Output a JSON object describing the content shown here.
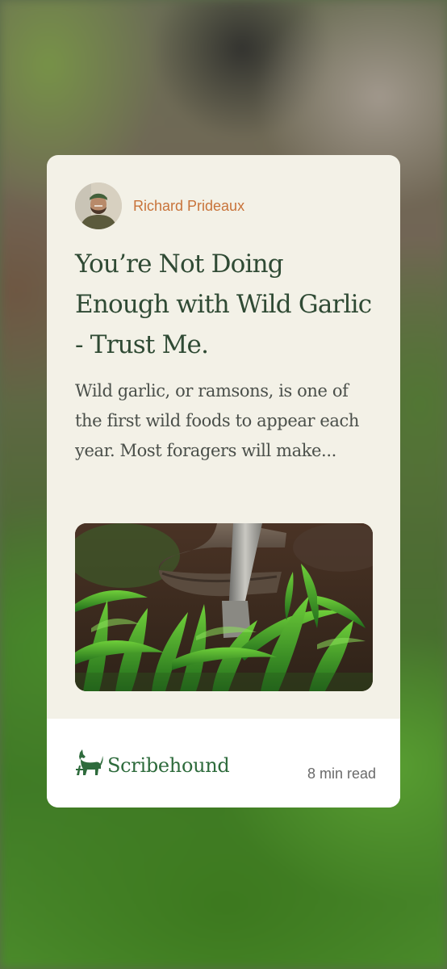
{
  "article": {
    "author": "Richard Prideaux",
    "title": "You’re Not Doing Enough with Wild Garlic - Trust Me.",
    "excerpt": "Wild garlic, or ramsons, is one of the first wild foods to appear each year. Most foragers will make...",
    "image": "wild-garlic-boot-spade-photo",
    "avatar": "author-avatar-photo"
  },
  "footer": {
    "brand": "Scribehound",
    "brand_icon": "hound-logo-icon",
    "read_time": "8 min read"
  },
  "colors": {
    "card_background": "#f3f1e7",
    "title": "#2f4a34",
    "author": "#c8733a",
    "brand": "#2e6b3c",
    "footer_background": "#ffffff"
  }
}
